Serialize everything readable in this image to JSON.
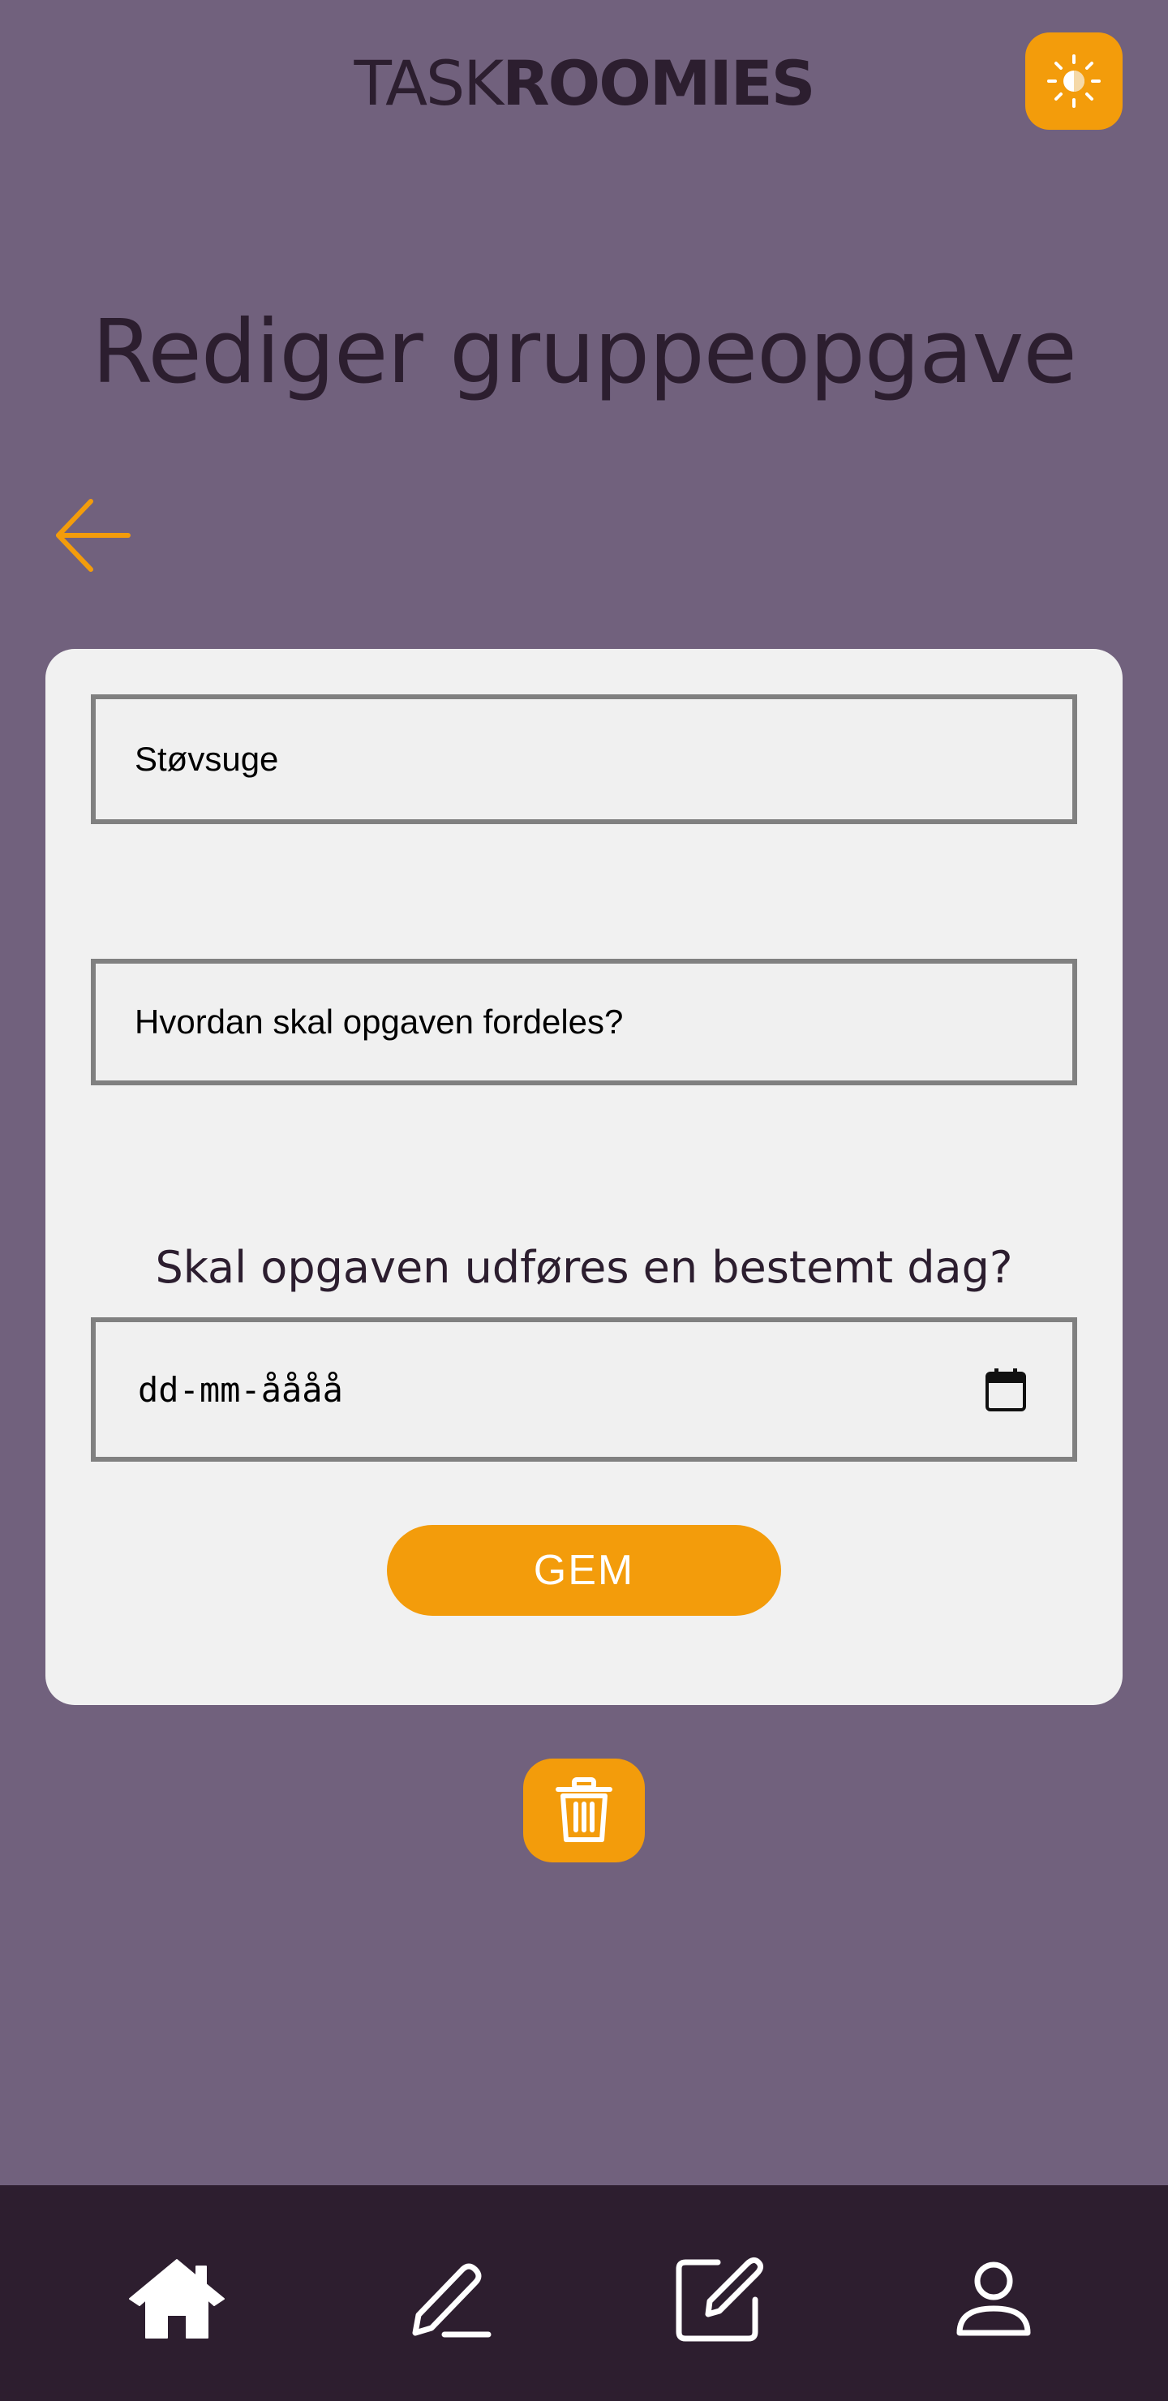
{
  "header": {
    "logo_light": "TASK",
    "logo_bold": "ROOMIES",
    "theme_toggle_icon": "sun-icon"
  },
  "page_title": "Rediger gruppeopgave",
  "back_icon": "arrow-left-icon",
  "form": {
    "task_name_value": "Støvsuge",
    "distribution_placeholder": "Hvordan skal opgaven fordeles?",
    "date_question": "Skal opgaven udføres en bestemt dag?",
    "date_placeholder": "dd-mm-åååå",
    "save_label": "GEM"
  },
  "delete_icon": "trash-icon",
  "bottom_nav": [
    {
      "icon": "home-icon"
    },
    {
      "icon": "pencil-icon"
    },
    {
      "icon": "edit-square-icon"
    },
    {
      "icon": "user-icon"
    }
  ],
  "colors": {
    "background": "#71617d",
    "accent": "#f39c0b",
    "card": "#f1f1f1",
    "nav": "#2d1e2f",
    "text_dark": "#2c1e2f"
  }
}
